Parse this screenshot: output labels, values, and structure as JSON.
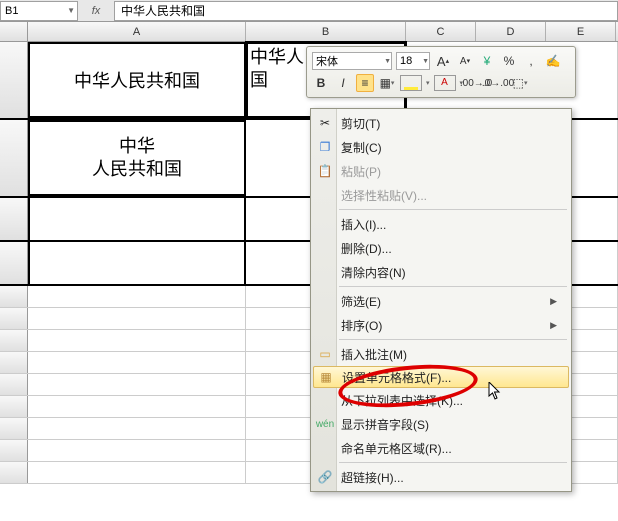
{
  "formula_bar": {
    "name_box": "B1",
    "fx": "fx",
    "value": "中华人民共和国"
  },
  "columns": {
    "A": "A",
    "B": "B",
    "C": "C",
    "D": "D",
    "E": "E"
  },
  "cells": {
    "A1": "中华人民共和国",
    "B1_visible": "中华人",
    "B1_wrapped": "国",
    "A2_line1": "中华",
    "A2_line2": "人民共和国"
  },
  "mini_toolbar": {
    "font": "宋体",
    "size": "18",
    "grow": "A",
    "shrink": "A",
    "bold": "B",
    "italic": "I",
    "percent": "%",
    "comma": ",",
    "format_painter": "✎"
  },
  "context_menu": {
    "cut": "剪切(T)",
    "copy": "复制(C)",
    "paste": "粘贴(P)",
    "paste_special": "选择性粘贴(V)...",
    "insert": "插入(I)...",
    "delete": "删除(D)...",
    "clear": "清除内容(N)",
    "filter": "筛选(E)",
    "sort": "排序(O)",
    "insert_comment": "插入批注(M)",
    "format_cells": "设置单元格格式(F)...",
    "dropdown": "从下拉列表中选择(K)...",
    "phonetic": "显示拼音字段(S)",
    "name_range": "命名单元格区域(R)...",
    "hyperlink": "超链接(H)..."
  }
}
